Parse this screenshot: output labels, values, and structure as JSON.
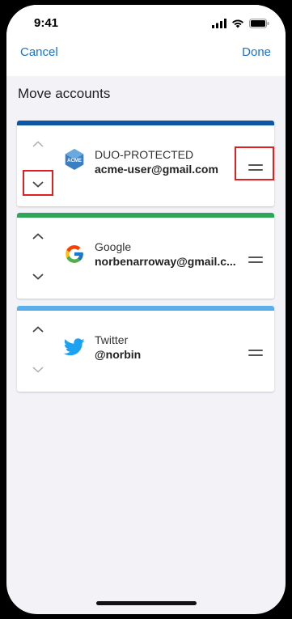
{
  "status_bar": {
    "time": "9:41"
  },
  "nav": {
    "cancel": "Cancel",
    "done": "Done"
  },
  "section_title": "Move accounts",
  "accounts": [
    {
      "name": "DUO-PROTECTED",
      "user": "acme-user@gmail.com",
      "bar_color": "#0d56a6",
      "icon": "acme-logo-icon"
    },
    {
      "name": "Google",
      "user": "norbenarroway@gmail.c...",
      "bar_color": "#2ea65a",
      "icon": "google-logo-icon"
    },
    {
      "name": "Twitter",
      "user": "@norbin",
      "bar_color": "#5aaeea",
      "icon": "twitter-logo-icon"
    }
  ],
  "colors": {
    "accent": "#1a73c8",
    "highlight": "#e02020"
  }
}
